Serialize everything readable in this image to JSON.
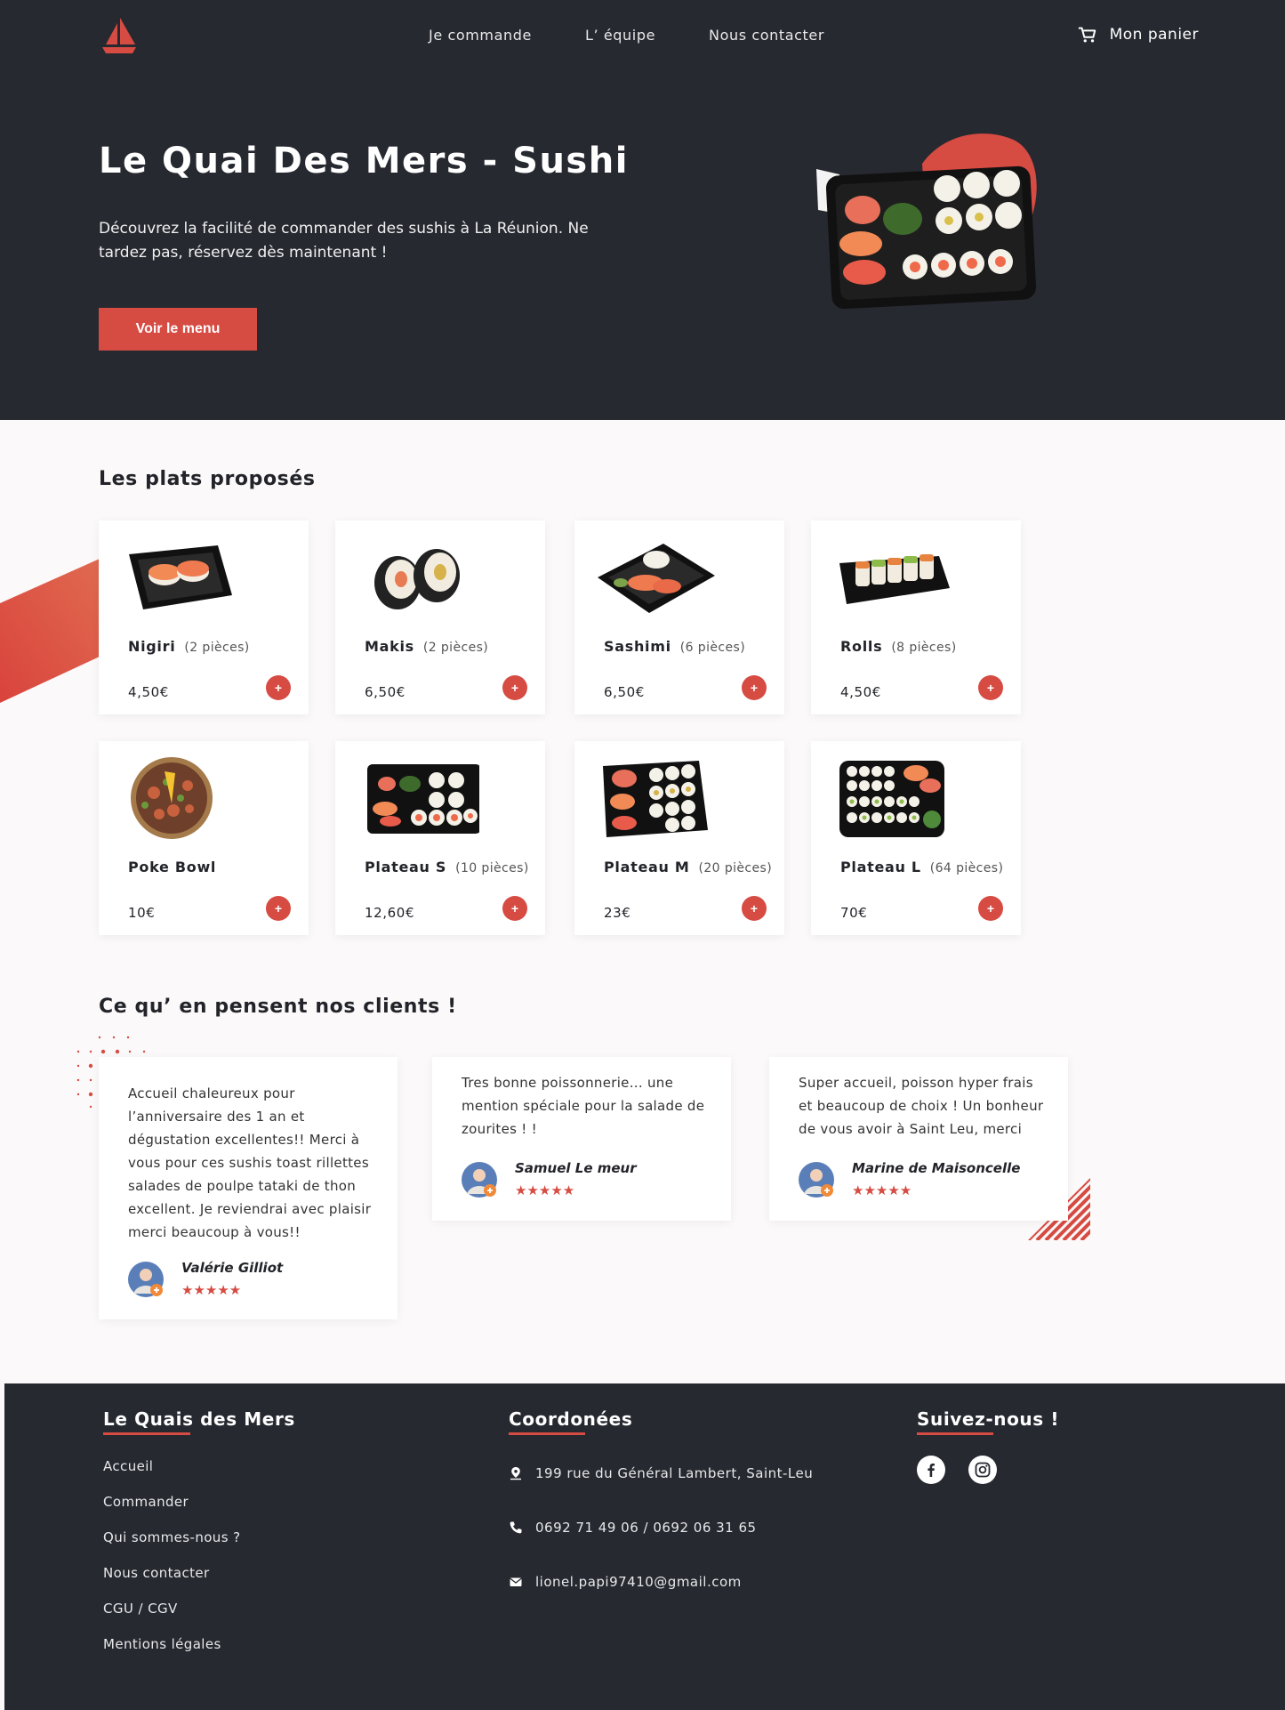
{
  "nav": {
    "links": [
      "Je commande",
      "L’ équipe",
      "Nous contacter"
    ],
    "cart_label": "Mon panier"
  },
  "hero": {
    "title": "Le Quai Des Mers - Sushi",
    "text": "Découvrez la facilité de commander des sushis à La Réunion. Ne tardez pas, réservez dès maintenant !",
    "button_label": "Voir le menu"
  },
  "products_section": {
    "title": "Les plats proposés",
    "items": [
      {
        "name": "Nigiri",
        "pieces": "(2 pièces)",
        "price": "4,50€",
        "add": "+"
      },
      {
        "name": "Makis",
        "pieces": "(2 pièces)",
        "price": "6,50€",
        "add": "+"
      },
      {
        "name": "Sashimi",
        "pieces": "(6 pièces)",
        "price": "6,50€",
        "add": "+"
      },
      {
        "name": "Rolls",
        "pieces": "(8 pièces)",
        "price": "4,50€",
        "add": "+"
      },
      {
        "name": "Poke Bowl",
        "pieces": "",
        "price": "10€",
        "add": "+"
      },
      {
        "name": "Plateau S",
        "pieces": "(10 pièces)",
        "price": "12,60€",
        "add": "+"
      },
      {
        "name": "Plateau M",
        "pieces": "(20 pièces)",
        "price": "23€",
        "add": "+"
      },
      {
        "name": "Plateau L",
        "pieces": "(64 pièces)",
        "price": "70€",
        "add": "+"
      }
    ]
  },
  "reviews_section": {
    "title": "Ce qu’ en pensent nos clients !",
    "items": [
      {
        "text": "Accueil chaleureux pour l’anniversaire des 1 an et dégustation excellentes!! Merci à vous pour ces sushis toast rillettes salades de poulpe tataki de thon excellent. Je reviendrai avec plaisir merci beaucoup à vous!!",
        "author": "Valérie Gilliot",
        "stars": "★★★★★"
      },
      {
        "text": "Tres bonne poissonnerie... une mention spéciale pour la salade de zourites ! !",
        "author": "Samuel Le meur",
        "stars": "★★★★★"
      },
      {
        "text": "Super accueil, poisson hyper frais et beaucoup de choix ! Un bonheur de vous avoir à Saint Leu, merci",
        "author": "Marine de Maisoncelle",
        "stars": "★★★★★"
      }
    ]
  },
  "footer": {
    "brand_title": "Le Quais des Mers",
    "links": [
      "Accueil",
      "Commander",
      "Qui sommes-nous ?",
      "Nous contacter",
      "CGU / CGV",
      "Mentions légales"
    ],
    "contact_title": "Coordonées",
    "address": "199 rue du Général Lambert, Saint-Leu",
    "phone": "0692 71 49 06 / 0692 06 31 65",
    "email": "lionel.papi97410@gmail.com",
    "social_title": "Suivez-nous !",
    "social_icons": [
      "facebook-icon",
      "instagram-icon"
    ]
  },
  "colors": {
    "accent": "#d64b42",
    "dark": "#262930",
    "background": "#fbf9f9"
  }
}
